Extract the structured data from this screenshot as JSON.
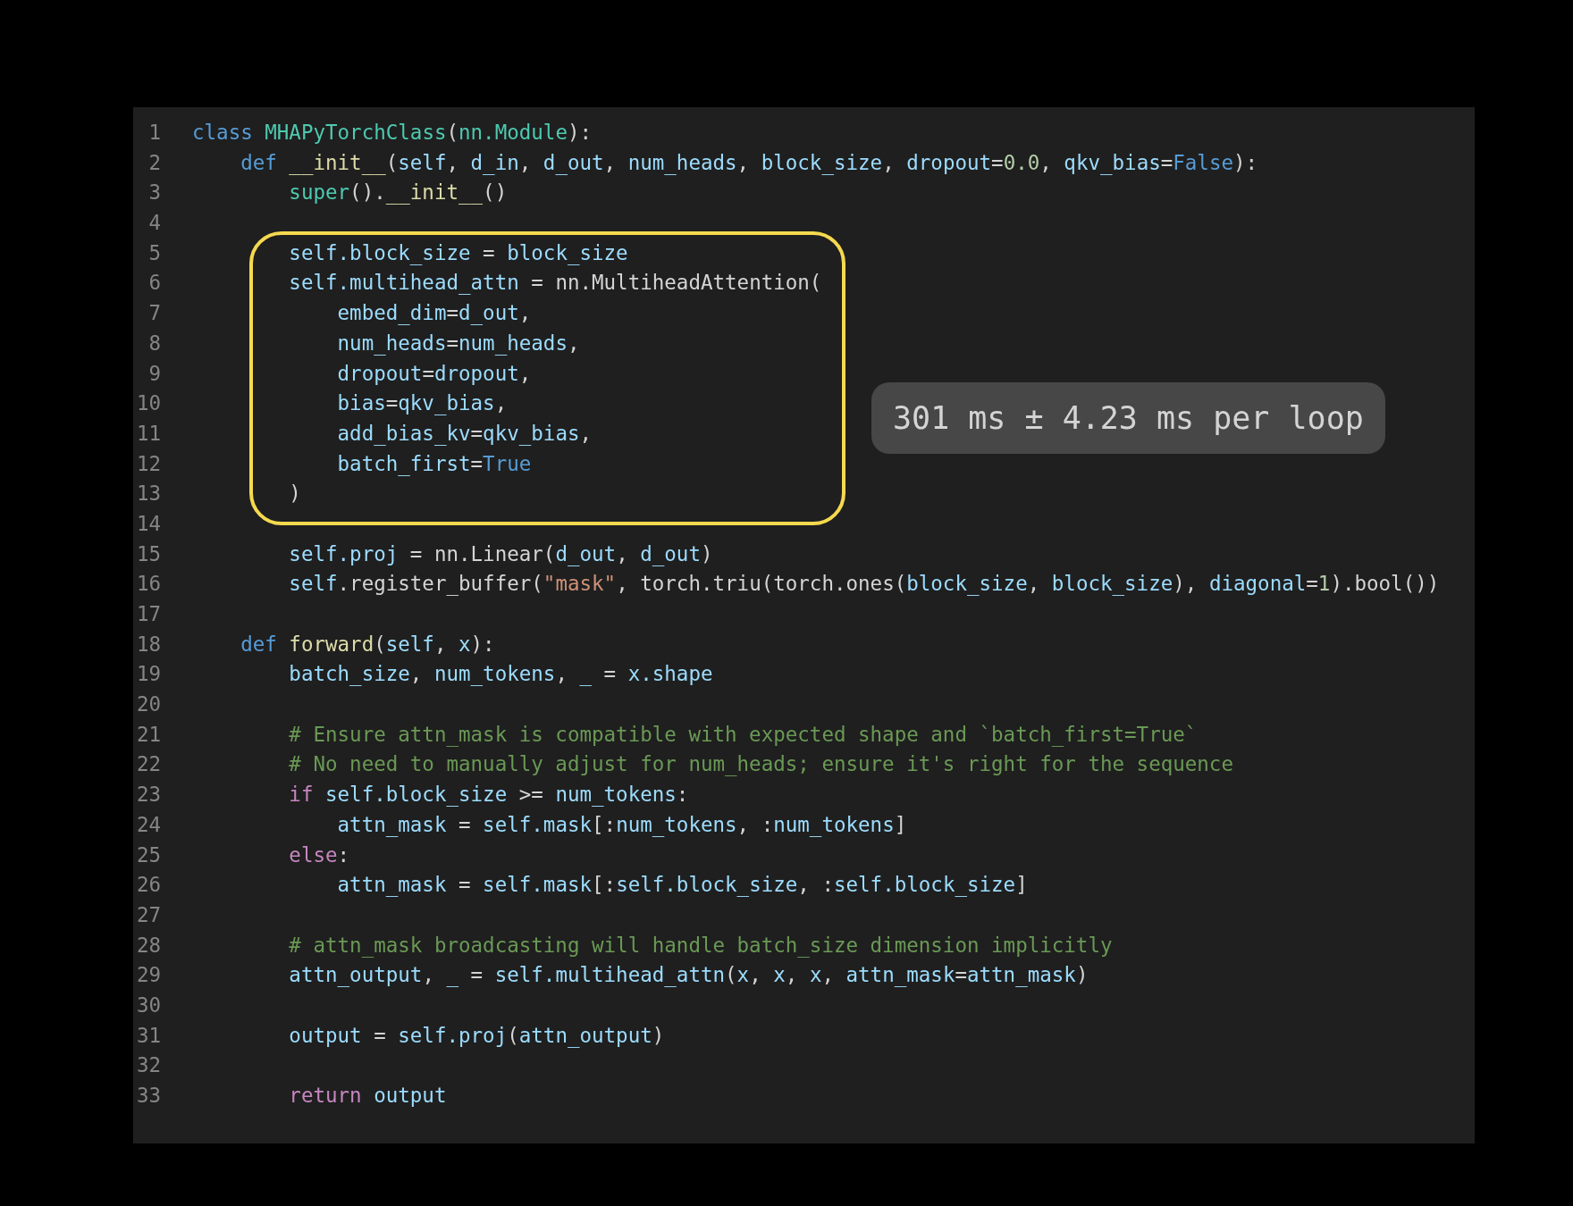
{
  "editor": {
    "lines": [
      {
        "number": "1",
        "tokens": [
          {
            "text": "class ",
            "kind": "keyword"
          },
          {
            "text": "MHAPyTorchClass",
            "kind": "type"
          },
          {
            "text": "(",
            "kind": "plain"
          },
          {
            "text": "nn.Module",
            "kind": "type"
          },
          {
            "text": "):",
            "kind": "plain"
          }
        ],
        "children": [
          {
            "number": "2",
            "tokens": [
              {
                "text": "def ",
                "kind": "keyword"
              },
              {
                "text": "__init__",
                "kind": "function"
              },
              {
                "text": "(",
                "kind": "plain"
              },
              {
                "text": "self",
                "kind": "variable"
              },
              {
                "text": ", ",
                "kind": "plain"
              },
              {
                "text": "d_in",
                "kind": "variable"
              },
              {
                "text": ", ",
                "kind": "plain"
              },
              {
                "text": "d_out",
                "kind": "variable"
              },
              {
                "text": ", ",
                "kind": "plain"
              },
              {
                "text": "num_heads",
                "kind": "variable"
              },
              {
                "text": ", ",
                "kind": "plain"
              },
              {
                "text": "block_size",
                "kind": "variable"
              },
              {
                "text": ", ",
                "kind": "plain"
              },
              {
                "text": "dropout",
                "kind": "variable"
              },
              {
                "text": "=",
                "kind": "plain"
              },
              {
                "text": "0.0",
                "kind": "number"
              },
              {
                "text": ", ",
                "kind": "plain"
              },
              {
                "text": "qkv_bias",
                "kind": "variable"
              },
              {
                "text": "=",
                "kind": "plain"
              },
              {
                "text": "False",
                "kind": "keyword"
              },
              {
                "text": "):",
                "kind": "plain"
              }
            ],
            "children": [
              {
                "number": "3",
                "tokens": [
                  {
                    "text": "super",
                    "kind": "type"
                  },
                  {
                    "text": "().",
                    "kind": "plain"
                  },
                  {
                    "text": "__init__",
                    "kind": "function"
                  },
                  {
                    "text": "()",
                    "kind": "plain"
                  }
                ]
              },
              {
                "number": "4"
              },
              {
                "number": "5",
                "tokens": [
                  {
                    "text": "self.block_size",
                    "kind": "variable"
                  },
                  {
                    "text": " = ",
                    "kind": "plain"
                  },
                  {
                    "text": "block_size",
                    "kind": "variable"
                  }
                ]
              },
              {
                "number": "6",
                "tokens": [
                  {
                    "text": "self.multihead_attn",
                    "kind": "variable"
                  },
                  {
                    "text": " = nn.MultiheadAttention(",
                    "kind": "plain"
                  }
                ],
                "children": [
                  {
                    "number": "7",
                    "tokens": [
                      {
                        "text": "embed_dim",
                        "kind": "variable"
                      },
                      {
                        "text": "=",
                        "kind": "plain"
                      },
                      {
                        "text": "d_out",
                        "kind": "variable"
                      },
                      {
                        "text": ",",
                        "kind": "plain"
                      }
                    ]
                  },
                  {
                    "number": "8",
                    "tokens": [
                      {
                        "text": "num_heads",
                        "kind": "variable"
                      },
                      {
                        "text": "=",
                        "kind": "plain"
                      },
                      {
                        "text": "num_heads",
                        "kind": "variable"
                      },
                      {
                        "text": ",",
                        "kind": "plain"
                      }
                    ]
                  },
                  {
                    "number": "9",
                    "tokens": [
                      {
                        "text": "dropout",
                        "kind": "variable"
                      },
                      {
                        "text": "=",
                        "kind": "plain"
                      },
                      {
                        "text": "dropout",
                        "kind": "variable"
                      },
                      {
                        "text": ",",
                        "kind": "plain"
                      }
                    ]
                  },
                  {
                    "number": "10",
                    "tokens": [
                      {
                        "text": "bias",
                        "kind": "variable"
                      },
                      {
                        "text": "=",
                        "kind": "plain"
                      },
                      {
                        "text": "qkv_bias",
                        "kind": "variable"
                      },
                      {
                        "text": ",",
                        "kind": "plain"
                      }
                    ]
                  },
                  {
                    "number": "11",
                    "tokens": [
                      {
                        "text": "add_bias_kv",
                        "kind": "variable"
                      },
                      {
                        "text": "=",
                        "kind": "plain"
                      },
                      {
                        "text": "qkv_bias",
                        "kind": "variable"
                      },
                      {
                        "text": ",",
                        "kind": "plain"
                      }
                    ]
                  },
                  {
                    "number": "12",
                    "tokens": [
                      {
                        "text": "batch_first",
                        "kind": "variable"
                      },
                      {
                        "text": "=",
                        "kind": "plain"
                      },
                      {
                        "text": "True",
                        "kind": "keyword"
                      }
                    ]
                  }
                ]
              },
              {
                "number": "13",
                "tokens": [
                  {
                    "text": ")",
                    "kind": "plain"
                  }
                ]
              },
              {
                "number": "14"
              },
              {
                "number": "15",
                "tokens": [
                  {
                    "text": "self.proj",
                    "kind": "variable"
                  },
                  {
                    "text": " = nn.Linear(",
                    "kind": "plain"
                  },
                  {
                    "text": "d_out",
                    "kind": "variable"
                  },
                  {
                    "text": ", ",
                    "kind": "plain"
                  },
                  {
                    "text": "d_out",
                    "kind": "variable"
                  },
                  {
                    "text": ")",
                    "kind": "plain"
                  }
                ]
              },
              {
                "number": "16",
                "tokens": [
                  {
                    "text": "self",
                    "kind": "variable"
                  },
                  {
                    "text": ".register_buffer(",
                    "kind": "plain"
                  },
                  {
                    "text": "\"mask\"",
                    "kind": "string"
                  },
                  {
                    "text": ", torch.triu(torch.ones(",
                    "kind": "plain"
                  },
                  {
                    "text": "block_size",
                    "kind": "variable"
                  },
                  {
                    "text": ", ",
                    "kind": "plain"
                  },
                  {
                    "text": "block_size",
                    "kind": "variable"
                  },
                  {
                    "text": "), ",
                    "kind": "plain"
                  },
                  {
                    "text": "diagonal",
                    "kind": "variable"
                  },
                  {
                    "text": "=",
                    "kind": "plain"
                  },
                  {
                    "text": "1",
                    "kind": "number"
                  },
                  {
                    "text": ").bool())",
                    "kind": "plain"
                  }
                ]
              }
            ]
          },
          {
            "number": "17"
          },
          {
            "number": "18",
            "tokens": [
              {
                "text": "def ",
                "kind": "keyword"
              },
              {
                "text": "forward",
                "kind": "function"
              },
              {
                "text": "(",
                "kind": "plain"
              },
              {
                "text": "self",
                "kind": "variable"
              },
              {
                "text": ", ",
                "kind": "plain"
              },
              {
                "text": "x",
                "kind": "variable"
              },
              {
                "text": "):",
                "kind": "plain"
              }
            ],
            "children": [
              {
                "number": "19",
                "tokens": [
                  {
                    "text": "batch_size",
                    "kind": "variable"
                  },
                  {
                    "text": ", ",
                    "kind": "plain"
                  },
                  {
                    "text": "num_tokens",
                    "kind": "variable"
                  },
                  {
                    "text": ", ",
                    "kind": "plain"
                  },
                  {
                    "text": "_",
                    "kind": "variable"
                  },
                  {
                    "text": " = ",
                    "kind": "plain"
                  },
                  {
                    "text": "x.shape",
                    "kind": "variable"
                  }
                ]
              },
              {
                "number": "20"
              },
              {
                "number": "21",
                "tokens": [
                  {
                    "text": "# Ensure attn_mask is compatible with expected shape and `batch_first=True`",
                    "kind": "comment"
                  }
                ]
              },
              {
                "number": "22",
                "tokens": [
                  {
                    "text": "# No need to manually adjust for num_heads; ensure it's right for the sequence",
                    "kind": "comment"
                  }
                ]
              },
              {
                "number": "23",
                "tokens": [
                  {
                    "text": "if ",
                    "kind": "control"
                  },
                  {
                    "text": "self.block_size",
                    "kind": "variable"
                  },
                  {
                    "text": " >= ",
                    "kind": "plain"
                  },
                  {
                    "text": "num_tokens",
                    "kind": "variable"
                  },
                  {
                    "text": ":",
                    "kind": "plain"
                  }
                ],
                "children": [
                  {
                    "number": "24",
                    "tokens": [
                      {
                        "text": "attn_mask",
                        "kind": "variable"
                      },
                      {
                        "text": " = ",
                        "kind": "plain"
                      },
                      {
                        "text": "self.mask",
                        "kind": "variable"
                      },
                      {
                        "text": "[:",
                        "kind": "plain"
                      },
                      {
                        "text": "num_tokens",
                        "kind": "variable"
                      },
                      {
                        "text": ", :",
                        "kind": "plain"
                      },
                      {
                        "text": "num_tokens",
                        "kind": "variable"
                      },
                      {
                        "text": "]",
                        "kind": "plain"
                      }
                    ]
                  }
                ]
              },
              {
                "number": "25",
                "tokens": [
                  {
                    "text": "else",
                    "kind": "control"
                  },
                  {
                    "text": ":",
                    "kind": "plain"
                  }
                ],
                "children": [
                  {
                    "number": "26",
                    "tokens": [
                      {
                        "text": "attn_mask",
                        "kind": "variable"
                      },
                      {
                        "text": " = ",
                        "kind": "plain"
                      },
                      {
                        "text": "self.mask",
                        "kind": "variable"
                      },
                      {
                        "text": "[:",
                        "kind": "plain"
                      },
                      {
                        "text": "self.block_size",
                        "kind": "variable"
                      },
                      {
                        "text": ", :",
                        "kind": "plain"
                      },
                      {
                        "text": "self.block_size",
                        "kind": "variable"
                      },
                      {
                        "text": "]",
                        "kind": "plain"
                      }
                    ]
                  }
                ]
              },
              {
                "number": "27"
              },
              {
                "number": "28",
                "tokens": [
                  {
                    "text": "# attn_mask broadcasting will handle batch_size dimension implicitly",
                    "kind": "comment"
                  }
                ]
              },
              {
                "number": "29",
                "tokens": [
                  {
                    "text": "attn_output",
                    "kind": "variable"
                  },
                  {
                    "text": ", ",
                    "kind": "plain"
                  },
                  {
                    "text": "_",
                    "kind": "variable"
                  },
                  {
                    "text": " = ",
                    "kind": "plain"
                  },
                  {
                    "text": "self.multihead_attn",
                    "kind": "variable"
                  },
                  {
                    "text": "(",
                    "kind": "plain"
                  },
                  {
                    "text": "x",
                    "kind": "variable"
                  },
                  {
                    "text": ", ",
                    "kind": "plain"
                  },
                  {
                    "text": "x",
                    "kind": "variable"
                  },
                  {
                    "text": ", ",
                    "kind": "plain"
                  },
                  {
                    "text": "x",
                    "kind": "variable"
                  },
                  {
                    "text": ", ",
                    "kind": "plain"
                  },
                  {
                    "text": "attn_mask",
                    "kind": "variable"
                  },
                  {
                    "text": "=",
                    "kind": "plain"
                  },
                  {
                    "text": "attn_mask",
                    "kind": "variable"
                  },
                  {
                    "text": ")",
                    "kind": "plain"
                  }
                ]
              },
              {
                "number": "30"
              },
              {
                "number": "31",
                "tokens": [
                  {
                    "text": "output",
                    "kind": "variable"
                  },
                  {
                    "text": " = ",
                    "kind": "plain"
                  },
                  {
                    "text": "self.proj",
                    "kind": "variable"
                  },
                  {
                    "text": "(",
                    "kind": "plain"
                  },
                  {
                    "text": "attn_output",
                    "kind": "variable"
                  },
                  {
                    "text": ")",
                    "kind": "plain"
                  }
                ]
              },
              {
                "number": "32"
              },
              {
                "number": "33",
                "tokens": [
                  {
                    "text": "return ",
                    "kind": "control"
                  },
                  {
                    "text": "output",
                    "kind": "variable"
                  }
                ]
              }
            ]
          }
        ]
      }
    ]
  },
  "timing_badge": {
    "text": "301 ms ± 4.23 ms per loop"
  }
}
